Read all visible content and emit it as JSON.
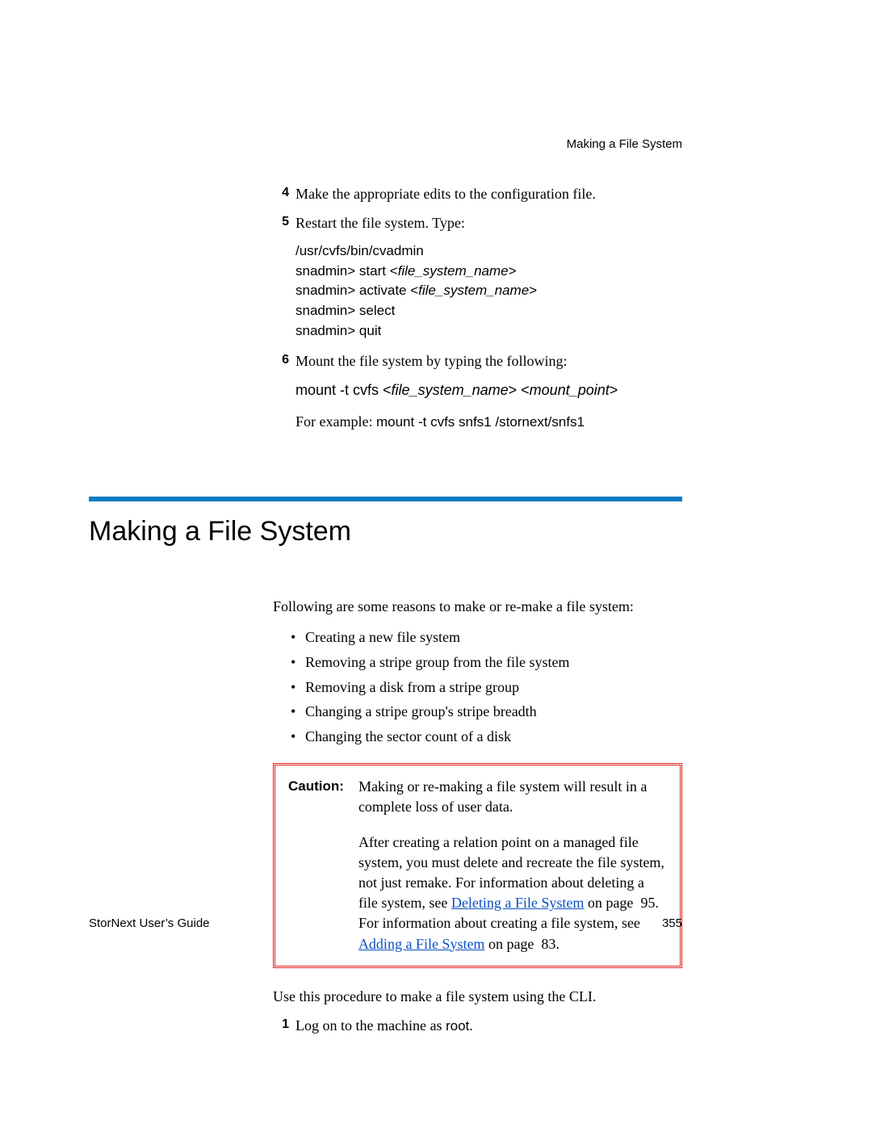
{
  "running_head": "Making a File System",
  "steps_top": {
    "s4": {
      "num": "4",
      "text": "Make the appropriate edits to the configuration file."
    },
    "s5": {
      "num": "5",
      "text": "Restart the file system. Type:"
    },
    "code5": {
      "l1": "/usr/cvfs/bin/cvadmin",
      "l2a": "snadmin> start <",
      "l2b": "file_system_name",
      "l2c": ">",
      "l3a": "snadmin> activate <",
      "l3b": "file_system_name",
      "l3c": ">",
      "l4": "snadmin> select",
      "l5": "snadmin> quit"
    },
    "s6": {
      "num": "6",
      "text": "Mount the file system by typing the following:"
    },
    "code6": {
      "a": "mount -t cvfs <",
      "b": "file_system_name",
      "c": "> <",
      "d": "mount_point",
      "e": ">"
    },
    "ex_prefix": "For example: ",
    "ex_code": "mount -t cvfs snfs1 /stornext/snfs1"
  },
  "section_title": "Making a File System",
  "intro": "Following are some reasons to make or re-make a file system:",
  "bullets": [
    "Creating a new file system",
    "Removing a stripe group from the file system",
    "Removing a disk from a stripe group",
    "Changing a stripe group's stripe breadth",
    "Changing the sector count of a disk"
  ],
  "caution": {
    "label": "Caution:",
    "p1": "Making or re-making a file system will result in a complete loss of user data.",
    "p2a": "After creating a relation point on a managed file system, you must delete and recreate the file system, not just remake. For information about deleting a file system, see ",
    "link1": "Deleting a File System",
    "p2b": " on page  95. For information about creating a file system, see ",
    "link2": "Adding a File System",
    "p2c": " on page  83."
  },
  "post_caution": "Use this procedure to make a file system using the CLI.",
  "step1": {
    "num": "1",
    "a": "Log on to the machine as ",
    "b": "root",
    "c": "."
  },
  "footer": {
    "left": "StorNext User’s Guide",
    "right": "355"
  }
}
